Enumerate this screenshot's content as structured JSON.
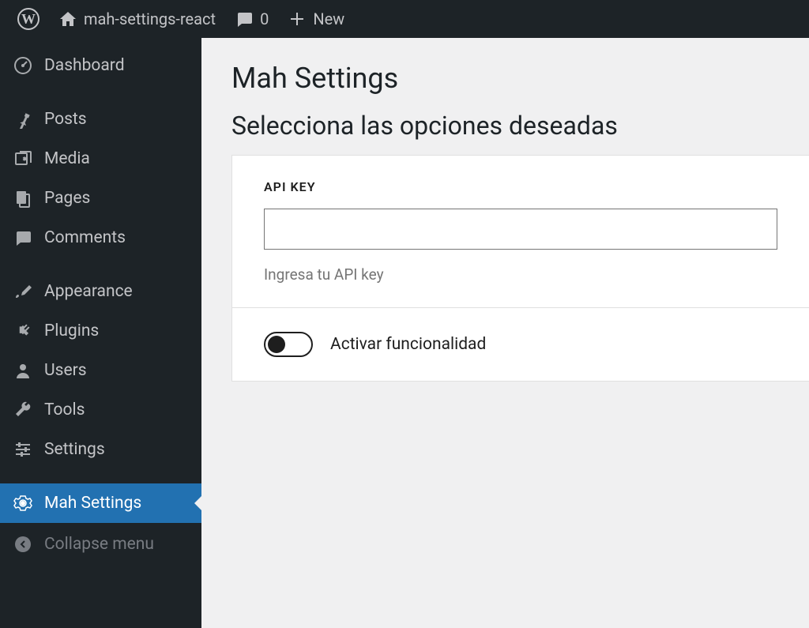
{
  "topbar": {
    "site_name": "mah-settings-react",
    "comments_count": "0",
    "new_label": "New"
  },
  "sidebar": {
    "items": [
      {
        "label": "Dashboard",
        "icon": "dashboard"
      },
      {
        "label": "Posts",
        "icon": "pin"
      },
      {
        "label": "Media",
        "icon": "media"
      },
      {
        "label": "Pages",
        "icon": "pages"
      },
      {
        "label": "Comments",
        "icon": "comment"
      },
      {
        "label": "Appearance",
        "icon": "brush"
      },
      {
        "label": "Plugins",
        "icon": "plug"
      },
      {
        "label": "Users",
        "icon": "user"
      },
      {
        "label": "Tools",
        "icon": "wrench"
      },
      {
        "label": "Settings",
        "icon": "sliders"
      },
      {
        "label": "Mah Settings",
        "icon": "gear"
      }
    ],
    "collapse_label": "Collapse menu"
  },
  "page": {
    "title": "Mah Settings",
    "subtitle": "Selecciona las opciones deseadas",
    "api_key_label": "API KEY",
    "api_key_value": "",
    "api_key_help": "Ingresa tu API key",
    "toggle_label": "Activar funcionalidad",
    "toggle_on": false
  }
}
